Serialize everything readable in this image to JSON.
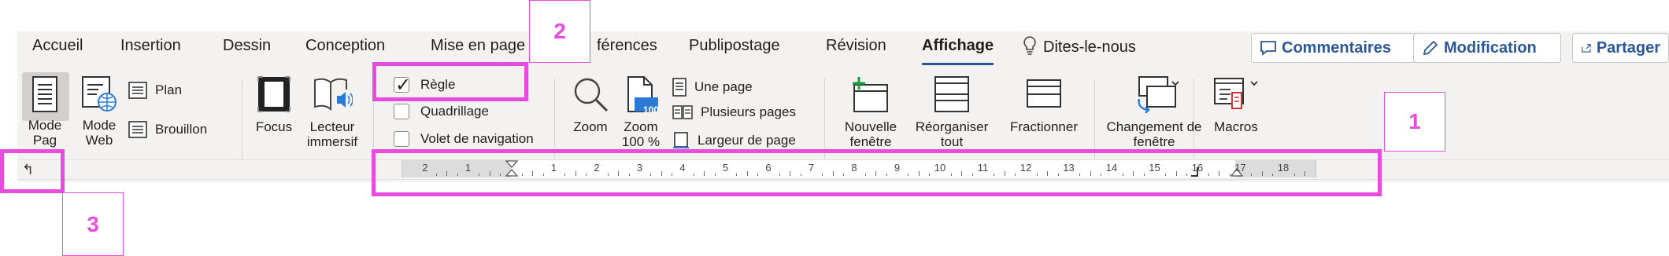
{
  "tabs": [
    {
      "label": "Accueil",
      "active": false
    },
    {
      "label": "Insertion",
      "active": false
    },
    {
      "label": "Dessin",
      "active": false
    },
    {
      "label": "Conception",
      "active": false
    },
    {
      "label": "Mise en page",
      "active": false
    },
    {
      "label": "férences",
      "active": false
    },
    {
      "label": "Publipostage",
      "active": false
    },
    {
      "label": "Révision",
      "active": false
    },
    {
      "label": "Affichage",
      "active": true
    }
  ],
  "tell_me": {
    "label": "Dites-le-nous",
    "icon": "lightbulb-icon"
  },
  "actions": {
    "comments": "Commentaires",
    "editing": "Modification",
    "share": "Partager"
  },
  "ribbon": {
    "views": {
      "print_layout": "Mode Pag",
      "web_layout": "Mode Web",
      "outline": "Plan",
      "draft": "Brouillon"
    },
    "immersive": {
      "focus": "Focus",
      "reader": "Lecteur immersif"
    },
    "show": {
      "ruler": {
        "label": "Règle",
        "checked": true
      },
      "gridlines": {
        "label": "Quadrillage",
        "checked": false
      },
      "nav_pane": {
        "label": "Volet de navigation",
        "checked": false
      }
    },
    "zoom": {
      "zoom": "Zoom",
      "zoom100": "Zoom 100 %",
      "zoom100_badge": "100",
      "one_page": "Une page",
      "multiple_pages": "Plusieurs pages",
      "page_width": "Largeur de page"
    },
    "window": {
      "new_window": "Nouvelle fenêtre",
      "arrange_all": "Réorganiser tout",
      "split": "Fractionner",
      "switch_windows": "Changement de fenêtre"
    },
    "macros": {
      "label": "Macros"
    }
  },
  "ruler": {
    "left_labels": [
      "2",
      "1"
    ],
    "right_labels": [
      "1",
      "2",
      "3",
      "4",
      "5",
      "6",
      "7",
      "8",
      "9",
      "10",
      "11",
      "12",
      "13",
      "14",
      "15",
      "16",
      "17",
      "18"
    ]
  },
  "tab_selector_glyph": "↰",
  "annotations": {
    "one": "1",
    "two": "2",
    "three": "3"
  },
  "colors": {
    "annotation": "#e64ddc",
    "accent": "#2b579a"
  }
}
